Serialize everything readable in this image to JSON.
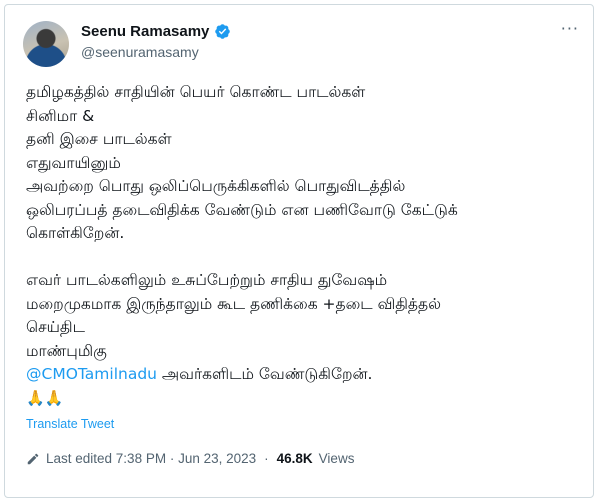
{
  "author": {
    "name": "Seenu Ramasamy",
    "handle": "@seenuramasamy",
    "verified": true
  },
  "more_label": "···",
  "tweet": {
    "lines_p1": [
      "தமிழகத்தில்  சாதியின் பெயர் கொண்ட பாடல்கள்",
      "சினிமா &",
      "தனி இசை பாடல்கள்",
      "எதுவாயினும்",
      "அவற்றை பொது ஒலிப்பெருக்கிகளில் பொதுவிடத்தில்",
      "ஒலிபரப்பத் தடைவிதிக்க வேண்டும் என பணிவோடு கேட்டுக்",
      "கொள்கிறேன்."
    ],
    "lines_p2": [
      "எவர் பாடல்களிலும் உசுப்பேற்றும் சாதிய துவேஷம்",
      "மறைமுகமாக இருந்தாலும் கூட தணிக்கை +தடை விதித்தல்",
      "செய்திட",
      "மாண்புமிகு"
    ],
    "mention": "@CMOTamilnadu",
    "mention_suffix": " அவர்களிடம் வேண்டுகிறேன்.",
    "emojis": "🙏🙏"
  },
  "translate_label": "Translate Tweet",
  "meta": {
    "edited": "Last edited 7:38 PM · Jun 23, 2023",
    "separator": "·",
    "views_count": "46.8K",
    "views_label": "Views"
  },
  "colors": {
    "link": "#1d9bf0",
    "verified": "#1d9bf0",
    "muted": "#536471",
    "text": "#0f1419"
  }
}
